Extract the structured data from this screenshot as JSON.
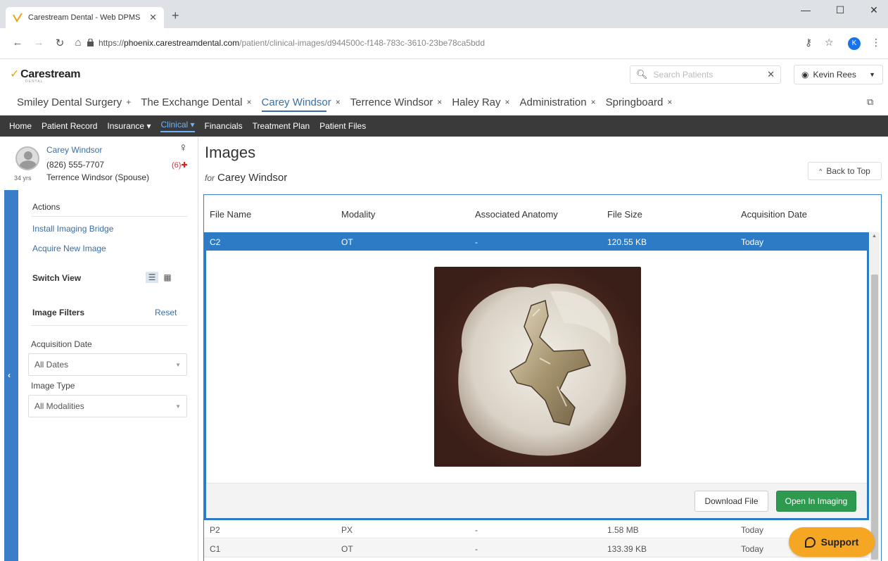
{
  "browser": {
    "tab_title": "Carestream Dental - Web DPMS",
    "url_prefix": "https://",
    "url_host": "phoenix.carestreamdental.com",
    "url_path": "/patient/clinical-images/d944500c-f148-783c-3610-23be78ca5bdd",
    "profile_initial": "K"
  },
  "app": {
    "logo": "Carestream",
    "logo_sub": "DENTAL",
    "search_placeholder": "Search Patients",
    "user": "Kevin Rees"
  },
  "patient_tabs": [
    {
      "label": "Smiley Dental Surgery",
      "icon": "+"
    },
    {
      "label": "The Exchange Dental",
      "icon": "×"
    },
    {
      "label": "Carey Windsor",
      "icon": "×",
      "active": true
    },
    {
      "label": "Terrence Windsor",
      "icon": "×"
    },
    {
      "label": "Haley Ray",
      "icon": "×"
    },
    {
      "label": "Administration",
      "icon": "×"
    },
    {
      "label": "Springboard",
      "icon": "×"
    }
  ],
  "nav": {
    "home": "Home",
    "patient_record": "Patient Record",
    "insurance": "Insurance",
    "clinical": "Clinical",
    "financials": "Financials",
    "treatment_plan": "Treatment Plan",
    "patient_files": "Patient Files"
  },
  "patient": {
    "name": "Carey Windsor",
    "phone": "(826) 555-7707",
    "spouse": "Terrence Windsor (Spouse)",
    "age": "34 yrs",
    "alerts": "(6)"
  },
  "sidebar": {
    "actions": "Actions",
    "install_bridge": "Install Imaging Bridge",
    "acquire_image": "Acquire New Image",
    "switch_view": "Switch View",
    "image_filters": "Image Filters",
    "reset": "Reset",
    "acq_date_label": "Acquisition Date",
    "acq_date_value": "All Dates",
    "image_type_label": "Image Type",
    "image_type_value": "All Modalities"
  },
  "page": {
    "title": "Images",
    "for_label": "for",
    "subject": "Carey Windsor",
    "back_to_top": "Back to Top"
  },
  "table": {
    "headers": {
      "file_name": "File Name",
      "modality": "Modality",
      "anatomy": "Associated Anatomy",
      "file_size": "File Size",
      "acq_date": "Acquisition Date"
    },
    "selected": {
      "name": "C2",
      "modality": "OT",
      "anatomy": "-",
      "size": "120.55 KB",
      "date": "Today"
    },
    "rows": [
      {
        "name": "P2",
        "modality": "PX",
        "anatomy": "-",
        "size": "1.58 MB",
        "date": "Today"
      },
      {
        "name": "C1",
        "modality": "OT",
        "anatomy": "-",
        "size": "133.39 KB",
        "date": "Today"
      }
    ]
  },
  "preview": {
    "download": "Download File",
    "open_imaging": "Open In Imaging"
  },
  "support": "Support",
  "colors": {
    "nav_bg": "#3a3a3a",
    "selected_row": "#2c7bc4",
    "open_button": "#2e9a4f",
    "support_button": "#f5a623",
    "link": "#3a6ea5"
  }
}
